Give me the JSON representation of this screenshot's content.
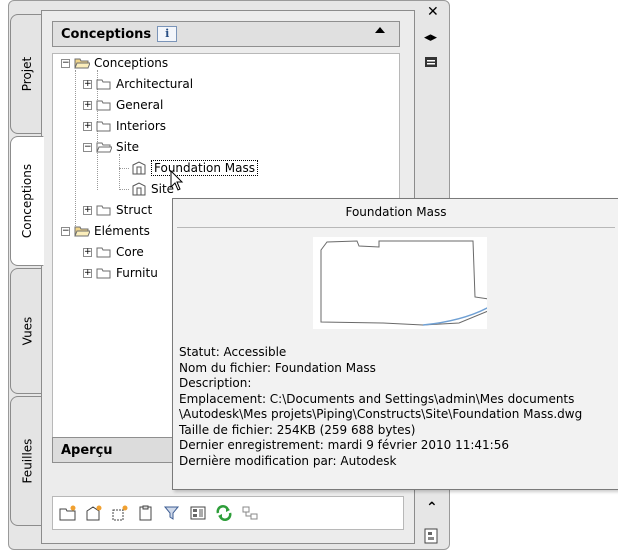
{
  "tabs": {
    "projet": "Projet",
    "conceptions": "Conceptions",
    "vues": "Vues",
    "feuilles": "Feuilles"
  },
  "section": {
    "title": "Conceptions",
    "info_icon": "i"
  },
  "tree": {
    "root": "Conceptions",
    "architectural": "Architectural",
    "general": "General",
    "interiors": "Interiors",
    "site": "Site",
    "foundation_mass": "Foundation Mass",
    "site_child": "Site",
    "struct": "Struct",
    "elements": "Eléments",
    "core": "Core",
    "furniture": "Furnitu"
  },
  "apercu": {
    "title": "Aperçu"
  },
  "tooltip": {
    "title": "Foundation Mass",
    "statut": "Statut: Accessible",
    "nom_fichier": "Nom du fichier: Foundation Mass",
    "description": "Description:",
    "emplacement_1": "Emplacement: C:\\Documents and Settings\\admin\\Mes documents",
    "emplacement_2": "\\Autodesk\\Mes projets\\Piping\\Constructs\\Site\\Foundation Mass.dwg",
    "taille": "Taille de fichier: 254KB (259 688 bytes)",
    "dernier_enregistrement": "Dernier enregistrement: mardi 9 février 2010  11:41:56",
    "derniere_modification": "Dernière modification par: Autodesk"
  },
  "colors": {
    "folder_yellow": "#f1d58a",
    "preview_arc": "#6fa0d4",
    "info_blue": "#274e85"
  }
}
